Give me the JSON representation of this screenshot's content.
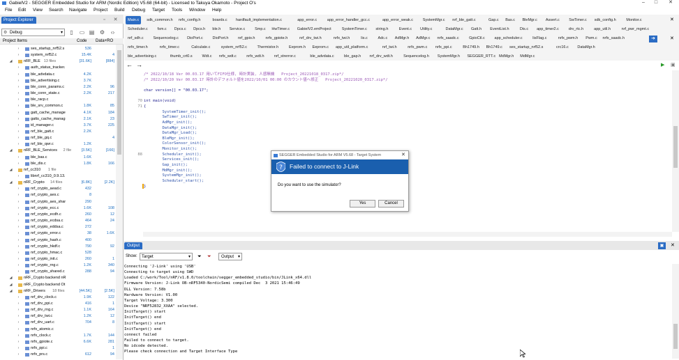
{
  "window": {
    "title": "GabielV2 - SEGGER Embedded Studio for ARM (Nordic Edition) V5.68 (64-bit) - Licensed to Takuya Okamoto - Project O's"
  },
  "menu": [
    "File",
    "Edit",
    "View",
    "Search",
    "Navigate",
    "Project",
    "Build",
    "Debug",
    "Target",
    "Tools",
    "Window",
    "Help"
  ],
  "explorer": {
    "title": "Project Explorer",
    "config": "Debug",
    "columns": {
      "name": "Project Items",
      "code": "Code",
      "data": "Data+RO"
    },
    "rows": [
      {
        "type": "file",
        "name": "ses_startup_nrf52.s",
        "code": "536",
        "data": ""
      },
      {
        "type": "file",
        "name": "system_nrf52.c",
        "code": "15.4K",
        "data": "4"
      },
      {
        "type": "folder",
        "name": "nRF_BLE",
        "count": "13 files",
        "code": "[31.6K]",
        "data": "[884]"
      },
      {
        "type": "file",
        "name": "auth_status_tracker.",
        "code": "",
        "data": ""
      },
      {
        "type": "file",
        "name": "ble_advdata.c",
        "code": "4.2K",
        "data": ""
      },
      {
        "type": "file",
        "name": "ble_advertising.c",
        "code": "3.7K",
        "data": ""
      },
      {
        "type": "file",
        "name": "ble_conn_params.c",
        "code": "2.2K",
        "data": "96"
      },
      {
        "type": "file",
        "name": "ble_conn_state.c",
        "code": "2.2K",
        "data": "217"
      },
      {
        "type": "file",
        "name": "ble_racp.c",
        "code": "",
        "data": ""
      },
      {
        "type": "file",
        "name": "ble_srv_common.c",
        "code": "1.8K",
        "data": "85"
      },
      {
        "type": "file",
        "name": "gatt_cache_manage",
        "code": "4.1K",
        "data": "184"
      },
      {
        "type": "file",
        "name": "gatts_cache_manag",
        "code": "2.1K",
        "data": "23"
      },
      {
        "type": "file",
        "name": "id_manager.c",
        "code": "3.7K",
        "data": "225"
      },
      {
        "type": "file",
        "name": "nrf_ble_gatt.c",
        "code": "2.2K",
        "data": ""
      },
      {
        "type": "file",
        "name": "nrf_ble_gq.c",
        "code": "",
        "data": "4"
      },
      {
        "type": "file",
        "name": "nrf_ble_qwr.c",
        "code": "1.2K",
        "data": ""
      },
      {
        "type": "folder",
        "name": "nRF_BLE_Services",
        "count": "2 file",
        "code": "[3.5K]",
        "data": "[166]"
      },
      {
        "type": "file",
        "name": "ble_bas.c",
        "code": "1.6K",
        "data": ""
      },
      {
        "type": "file",
        "name": "ble_dis.c",
        "code": "1.8K",
        "data": "166"
      },
      {
        "type": "folder",
        "name": "nrf_cc310",
        "count": "1 file",
        "code": "",
        "data": ""
      },
      {
        "type": "file",
        "name": "libnrf_cc310_0.9.13.",
        "code": "",
        "data": ""
      },
      {
        "type": "folder",
        "name": "nRF_Crypto",
        "count": "14 files",
        "code": "[6.8K]",
        "data": "[2.2K]"
      },
      {
        "type": "file",
        "name": "nrf_crypto_aead.c",
        "code": "432",
        "data": ""
      },
      {
        "type": "file",
        "name": "nrf_crypto_aes.c",
        "code": "8",
        "data": ""
      },
      {
        "type": "file",
        "name": "nrf_crypto_aes_shar",
        "code": "290",
        "data": ""
      },
      {
        "type": "file",
        "name": "nrf_crypto_ecc.c",
        "code": "1.6K",
        "data": "108"
      },
      {
        "type": "file",
        "name": "nrf_crypto_ecdh.c",
        "code": "260",
        "data": "12"
      },
      {
        "type": "file",
        "name": "nrf_crypto_ecdsa.c",
        "code": "464",
        "data": "24"
      },
      {
        "type": "file",
        "name": "nrf_crypto_eddsa.c",
        "code": "272",
        "data": ""
      },
      {
        "type": "file",
        "name": "nrf_crypto_error.c",
        "code": "38",
        "data": "1.6K"
      },
      {
        "type": "file",
        "name": "nrf_crypto_hash.c",
        "code": "400",
        "data": ""
      },
      {
        "type": "file",
        "name": "nrf_crypto_hkdf.c",
        "code": "790",
        "data": "92"
      },
      {
        "type": "file",
        "name": "nrf_crypto_hmac.c",
        "code": "528",
        "data": ""
      },
      {
        "type": "file",
        "name": "nrf_crypto_init.c",
        "code": "260",
        "data": "1"
      },
      {
        "type": "file",
        "name": "nrf_crypto_rng.c",
        "code": "1.2K",
        "data": "340"
      },
      {
        "type": "file",
        "name": "nrf_crypto_shared.c",
        "code": "288",
        "data": "94"
      },
      {
        "type": "folder",
        "name": "nRF_Crypto backend nR",
        "count": "",
        "code": "",
        "data": ""
      },
      {
        "type": "folder",
        "name": "nRF_Crypto backend Ot",
        "count": "",
        "code": "",
        "data": ""
      },
      {
        "type": "folder",
        "name": "nRF_Drivers",
        "count": "18 files",
        "code": "[44.5K]",
        "data": "[2.5K]"
      },
      {
        "type": "file",
        "name": "nrf_drv_clock.c",
        "code": "1.9K",
        "data": "122"
      },
      {
        "type": "file",
        "name": "nrf_drv_ppi.c",
        "code": "416",
        "data": "1"
      },
      {
        "type": "file",
        "name": "nrf_drv_rng.c",
        "code": "1.1K",
        "data": "164"
      },
      {
        "type": "file",
        "name": "nrf_drv_twi.c",
        "code": "1.2K",
        "data": "12"
      },
      {
        "type": "file",
        "name": "nrf_drv_uart.c",
        "code": "704",
        "data": "8"
      },
      {
        "type": "file",
        "name": "nrfx_atomic.c",
        "code": "",
        "data": ""
      },
      {
        "type": "file",
        "name": "nrfx_clock.c",
        "code": "1.7K",
        "data": "144"
      },
      {
        "type": "file",
        "name": "nrfx_gpiote.c",
        "code": "6.6K",
        "data": "281"
      },
      {
        "type": "file",
        "name": "nrfx_ppi.c",
        "code": "",
        "data": "1"
      },
      {
        "type": "file",
        "name": "nrfx_prs.c",
        "code": "612",
        "data": "94"
      }
    ]
  },
  "tabs": {
    "row1": [
      "Main.c",
      "sdk_common.h",
      "nrfx_config.h",
      "boards.c",
      "hardfault_implementation.c",
      "app_error.c",
      "app_error_handler_gcc.c",
      "app_error_weak.c",
      "SystemMgr.c",
      "nrf_ble_gatt.c",
      "Gap.c",
      "Bas.c",
      "BleMgr.c",
      "Assert.c",
      "SwTimer.c",
      "sdk_config.h",
      "Monitor.c"
    ],
    "row2": [
      "Scheduler.c",
      "fsm.c",
      "Dpcs.c",
      "Dpcs.h",
      "ble.h",
      "Service.c",
      "Smp.c",
      "HwTimer.c",
      "GabielV2.emProject",
      "SystemTimer.c",
      "string.h",
      "Event.c",
      "Utility.c",
      "DataMgr.c",
      "Gatt.h",
      "EventList.h",
      "Dis.c",
      "app_timer2.c",
      "drv_rtc.h",
      "app_util.h",
      "nrf_pwr_mgmt.c"
    ],
    "row3": [
      "nrf_sdh.c",
      "Sequencelog.c",
      "DioPort.c",
      "DioPort.h",
      "nrf_gpio.h",
      "nrfx_gpiote.h",
      "nrf_drv_twi.h",
      "nrfx_twi.h",
      "lis.c",
      "Adc.c",
      "AdMgr.h",
      "AdMgr.c",
      "nrfx_saadc.c",
      "GpioCtl.c",
      "app_scheduler.c",
      "lisFlag.c",
      "nrfx_pwm.h",
      "Pwm.c",
      "nrfx_saadc.h"
    ],
    "row4": [
      "nrfx_timer.h",
      "nrfx_timer.c",
      "Calculate.c",
      "system_nrf52.c",
      "Thermistor.h",
      "Eeprom.h",
      "Eeprom.c",
      "app_util_platform.c",
      "nrf_twi.h",
      "nrfx_pwm.c",
      "nrfx_ppi.c",
      "Bh1749.h",
      "Bh1749.c",
      "ses_startup_nrf52.s",
      "crc16.c",
      "DataMgr.h"
    ],
    "row5": [
      "ble_advertising.c",
      "thumb_crt0.s",
      "Wdt.c",
      "nrfx_wdt.c",
      "nrfx_wdt.h",
      "nrf_strerror.c",
      "ble_advdata.c",
      "ble_gap.h",
      "nrf_drv_wdt.h",
      "Sequencelog.h",
      "SystemMgr.h",
      "SEGGER_RTT.c",
      "MdMgr.h",
      "MdMgr.c"
    ]
  },
  "editor": {
    "lines": [
      {
        "num": "",
        "text": "/* 2022/10/18 Ver 00.03.17 用いてFIFO仕様, 時計実装, 人感無機   Project_20221018_0317.zip*/",
        "cls": "cm"
      },
      {
        "num": "",
        "text": "/* 2022/10/20 Ver 00.03.17 時計のデフォルト値を2022/10/01 00:00 のカウント値へ修正   Project_20221020_0317.zip*/",
        "cls": "cm"
      },
      {
        "num": "",
        "text": "",
        "cls": ""
      },
      {
        "num": "",
        "text": "char version[] = \"00.03.17\";",
        "cls": "kw"
      },
      {
        "num": "",
        "text": "",
        "cls": ""
      },
      {
        "num": "70",
        "text": "int main(void)",
        "cls": "kw"
      },
      {
        "num": "71",
        "text": "{",
        "cls": "kw"
      },
      {
        "num": "",
        "text": "        SystemTimer_init();",
        "cls": "fn"
      },
      {
        "num": "",
        "text": "        SwTimer_init();",
        "cls": "fn"
      },
      {
        "num": "",
        "text": "        AdMgr_init();",
        "cls": "fn"
      },
      {
        "num": "",
        "text": "        DataMgr_init();",
        "cls": "fn"
      },
      {
        "num": "",
        "text": "        DataMgr_Load();",
        "cls": "fn"
      },
      {
        "num": "",
        "text": "        BleMgr_init();",
        "cls": "fn"
      },
      {
        "num": "",
        "text": "        ColorSensor_init();",
        "cls": "fn"
      },
      {
        "num": "",
        "text": "        Monitor_init();",
        "cls": "fn"
      },
      {
        "num": "88",
        "text": "        Scheduler_init();",
        "cls": "fn"
      },
      {
        "num": "",
        "text": "        Services_init();",
        "cls": "fn"
      },
      {
        "num": "",
        "text": "        Gap_init();",
        "cls": "fn"
      },
      {
        "num": "",
        "text": "        MdMgr_init();",
        "cls": "fn"
      },
      {
        "num": "",
        "text": "        SystemMgr_init();",
        "cls": "fn"
      },
      {
        "num": "",
        "text": "        Scheduler_start();",
        "cls": "fn"
      },
      {
        "num": "",
        "text": "}",
        "cls": "kw"
      }
    ]
  },
  "output": {
    "title": "Output",
    "show_label": "Show:",
    "show_value": "Target",
    "output_menu": "Output",
    "lines": [
      "Connecting 'J-Link' using 'USB'",
      "Connecting to target using SWD",
      "Loaded C:/work/Tool/nRF/v1.8.0/toolchain/segger_embedded_studio/bin/JLink_x64.dll",
      "Firmware Version: J-Link OB-nRF5340-NordicSemi compiled Dec  3 2021 15:46:49",
      "DLL Version: 7.58b",
      "Hardware Version: V1.00",
      "Target Voltage: 3.300",
      "Device \"NRF52832_XXAA\" selected.",
      "InitTarget() start",
      "InitTarget() end",
      "InitTarget() start",
      "InitTarget() end",
      "connect failed",
      "Failed to connect to target.",
      "No idcode detected.",
      "Please check connection and Target Interface Type"
    ]
  },
  "dialog": {
    "title": "SEGGER Embedded Studio for ARM V5.68 - Target System",
    "heading": "Failed to connect to J-Link",
    "message": "Do you want to use the simulator?",
    "yes": "Yes",
    "cancel": "Cancel"
  },
  "colors": {
    "accent": "#2b6cc4",
    "dialog_band": "#1a5fae",
    "comment": "#9b59b6",
    "function": "#2a4fa8",
    "keyword": "#1c1c8c"
  }
}
